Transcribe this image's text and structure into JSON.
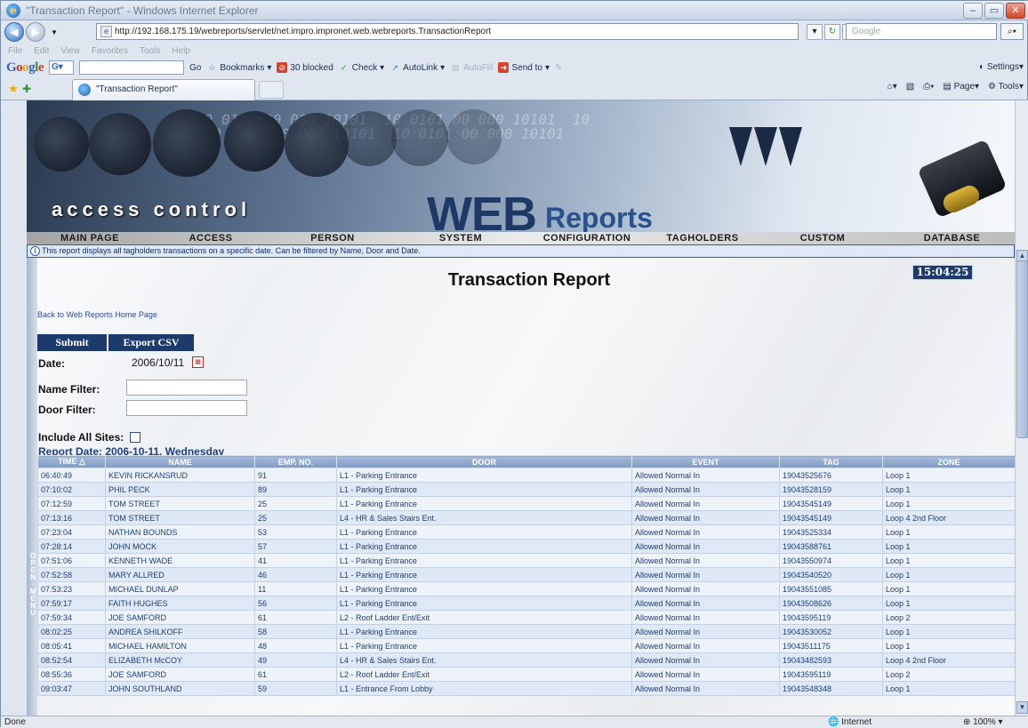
{
  "browser": {
    "title": "\"Transaction Report\" - Windows Internet Explorer",
    "url": "http://192.168.175.19/webreports/servlet/net.impro.impronet.web.webreports.TransactionReport",
    "search_placeholder": "Google",
    "menu": [
      "File",
      "Edit",
      "View",
      "Favorites",
      "Tools",
      "Help"
    ],
    "google_toolbar": {
      "go": "Go",
      "bookmarks": "Bookmarks",
      "blocked": "30 blocked",
      "check": "Check",
      "autolink": "AutoLink",
      "autofill": "AutoFill",
      "sendto": "Send to",
      "settings": "Settings"
    },
    "tab_label": "\"Transaction Report\"",
    "commands": {
      "page": "Page",
      "tools": "Tools"
    },
    "status": {
      "left": "Done",
      "zone": "Internet",
      "zoom": "100%"
    }
  },
  "banner": {
    "access_control": "access control",
    "web": "WEB",
    "reports": "Reports"
  },
  "nav": [
    "MAIN PAGE",
    "ACCESS",
    "PERSON",
    "SYSTEM",
    "CONFIGURATION",
    "TAGHOLDERS",
    "CUSTOM",
    "DATABASE"
  ],
  "info": "This report displays all tagholders transactions on a specific date. Can be filtered by Name, Door and Date.",
  "clock": "15:04:25",
  "report": {
    "title": "Transaction Report",
    "back_link": "Back to Web Reports Home Page",
    "submit": "Submit",
    "export": "Export CSV",
    "date_label": "Date:",
    "date_value": "2006/10/11",
    "name_filter_label": "Name Filter:",
    "door_filter_label": "Door Filter:",
    "include_all_label": "Include All Sites:",
    "report_date": "Report Date: 2006-10-11, Wednesday",
    "side_label": "OPEN MENU"
  },
  "table": {
    "columns": [
      "TIME",
      "NAME",
      "EMP. NO.",
      "DOOR",
      "EVENT",
      "TAG",
      "ZONE"
    ],
    "rows": [
      [
        "06:40:49",
        "KEVIN RICKANSRUD",
        "91",
        "L1 - Parking Entrance",
        "Allowed Normal In",
        "19043525676",
        "Loop 1"
      ],
      [
        "07:10:02",
        "PHIL PECK",
        "89",
        "L1 - Parking Entrance",
        "Allowed Normal In",
        "19043528159",
        "Loop 1"
      ],
      [
        "07:12:59",
        "TOM STREET",
        "25",
        "L1 - Parking Entrance",
        "Allowed Normal In",
        "19043545149",
        "Loop 1"
      ],
      [
        "07:13:16",
        "TOM STREET",
        "25",
        "L4 - HR & Sales Stairs Ent.",
        "Allowed Normal In",
        "19043545149",
        "Loop 4 2nd Floor"
      ],
      [
        "07:23:04",
        "NATHAN BOUNDS",
        "53",
        "L1 - Parking Entrance",
        "Allowed Normal In",
        "19043525334",
        "Loop 1"
      ],
      [
        "07:28:14",
        "JOHN MOCK",
        "57",
        "L1 - Parking Entrance",
        "Allowed Normal In",
        "19043588761",
        "Loop 1"
      ],
      [
        "07:51:06",
        "KENNETH WADE",
        "41",
        "L1 - Parking Entrance",
        "Allowed Normal In",
        "19043550974",
        "Loop 1"
      ],
      [
        "07:52:58",
        "MARY ALLRED",
        "46",
        "L1 - Parking Entrance",
        "Allowed Normal In",
        "19043540520",
        "Loop 1"
      ],
      [
        "07:53:23",
        "MICHAEL DUNLAP",
        "11",
        "L1 - Parking Entrance",
        "Allowed Normal In",
        "19043551085",
        "Loop 1"
      ],
      [
        "07:59:17",
        "FAITH HUGHES",
        "56",
        "L1 - Parking Entrance",
        "Allowed Normal In",
        "19043508626",
        "Loop 1"
      ],
      [
        "07:59:34",
        "JOE SAMFORD",
        "61",
        "L2 - Roof Ladder Ent/Exit",
        "Allowed Normal In",
        "19043595119",
        "Loop 2"
      ],
      [
        "08:02:25",
        "ANDREA SHILKOFF",
        "58",
        "L1 - Parking Entrance",
        "Allowed Normal In",
        "19043530052",
        "Loop 1"
      ],
      [
        "08:05:41",
        "MICHAEL HAMILTON",
        "48",
        "L1 - Parking Entrance",
        "Allowed Normal In",
        "19043511175",
        "Loop 1"
      ],
      [
        "08:52:54",
        "ELIZABETH McCOY",
        "49",
        "L4 - HR & Sales Stairs Ent.",
        "Allowed Normal In",
        "19043482593",
        "Loop 4 2nd Floor"
      ],
      [
        "08:55:36",
        "JOE SAMFORD",
        "61",
        "L2 - Roof Ladder Ent/Exit",
        "Allowed Normal In",
        "19043595119",
        "Loop 2"
      ],
      [
        "09:03:47",
        "JOHN SOUTHLAND",
        "59",
        "L1 - Entrance From Lobby",
        "Allowed Normal In",
        "19043548348",
        "Loop 1"
      ]
    ]
  }
}
